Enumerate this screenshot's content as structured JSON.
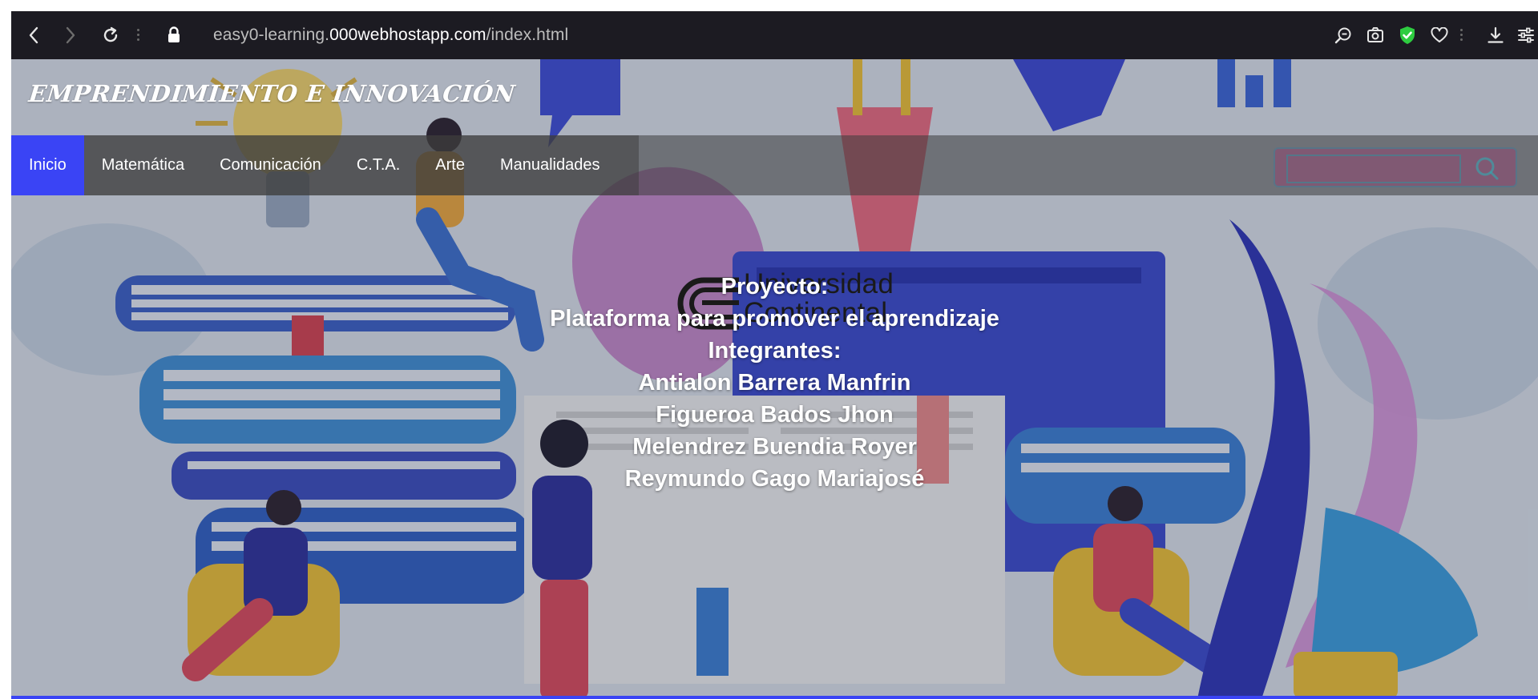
{
  "browser": {
    "url_prefix": "easy0-learning.",
    "url_host": "000webhostapp.com",
    "url_path": "/index.html",
    "back_icon": "back-arrow-icon",
    "forward_icon": "forward-arrow-icon",
    "reload_icon": "reload-icon",
    "lock_icon": "lock-icon",
    "toolbar_icons": [
      "zoom-icon",
      "screenshot-icon",
      "shield-check-icon",
      "heart-icon",
      "download-icon",
      "settings-sliders-icon"
    ],
    "colors": {
      "toolbar_bg": "#1c1b22",
      "shield": "#2ecc40"
    }
  },
  "site": {
    "title": "EMPRENDIMIENTO E INNOVACIÓN",
    "nav": [
      {
        "label": "Inicio",
        "active": true
      },
      {
        "label": "Matemática",
        "active": false
      },
      {
        "label": "Comunicación",
        "active": false
      },
      {
        "label": "C.T.A.",
        "active": false
      },
      {
        "label": "Arte",
        "active": false
      },
      {
        "label": "Manualidades",
        "active": false
      }
    ],
    "search_placeholder": "",
    "accent_color": "#3a44f5"
  },
  "content": {
    "logo": {
      "line1": "Universidad",
      "line2": "Continental",
      "icon": "university-logo-icon"
    },
    "project_label": "Proyecto:",
    "project_title": "Plataforma para promover el aprendizaje",
    "members_label": "Integrantes:",
    "members": [
      "Antialon Barrera Manfrin",
      "Figueroa Bados Jhon",
      "Melendrez Buendia Royer",
      "Reymundo Gago Mariajosé"
    ]
  }
}
